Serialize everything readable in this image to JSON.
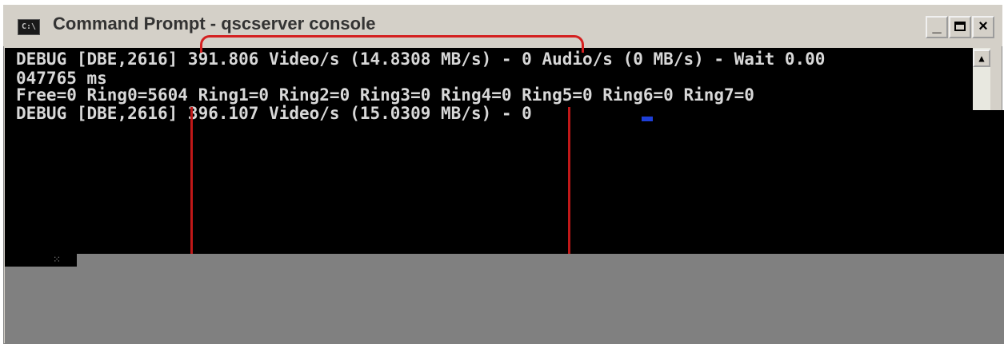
{
  "window": {
    "title": "Command Prompt - qscserver console",
    "icon": "cmd-icon",
    "icon_text": "C:\\"
  },
  "title_buttons": {
    "minimize": "_",
    "close": "×"
  },
  "console": {
    "lines": [
      "DEBUG [DBE,2616] 391.806 Video/s (14.8308 MB/s) - 0 Audio/s (0 MB/s) - Wait 0.00",
      "047765 ms",
      "Free=0 Ring0=5604 Ring1=0 Ring2=0 Ring3=0 Ring4=0 Ring5=0 Ring6=0 Ring7=0",
      "DEBUG [DBE,2616] 396.107 Video/s (15.0309 MB/s) - 0 "
    ]
  },
  "scrollbar": {
    "up_arrow": "▲"
  },
  "colors": {
    "console_bg": "#000000",
    "console_text": "#d8d8d8",
    "highlight": "#d42020",
    "cursor": "#1e3fd8"
  }
}
